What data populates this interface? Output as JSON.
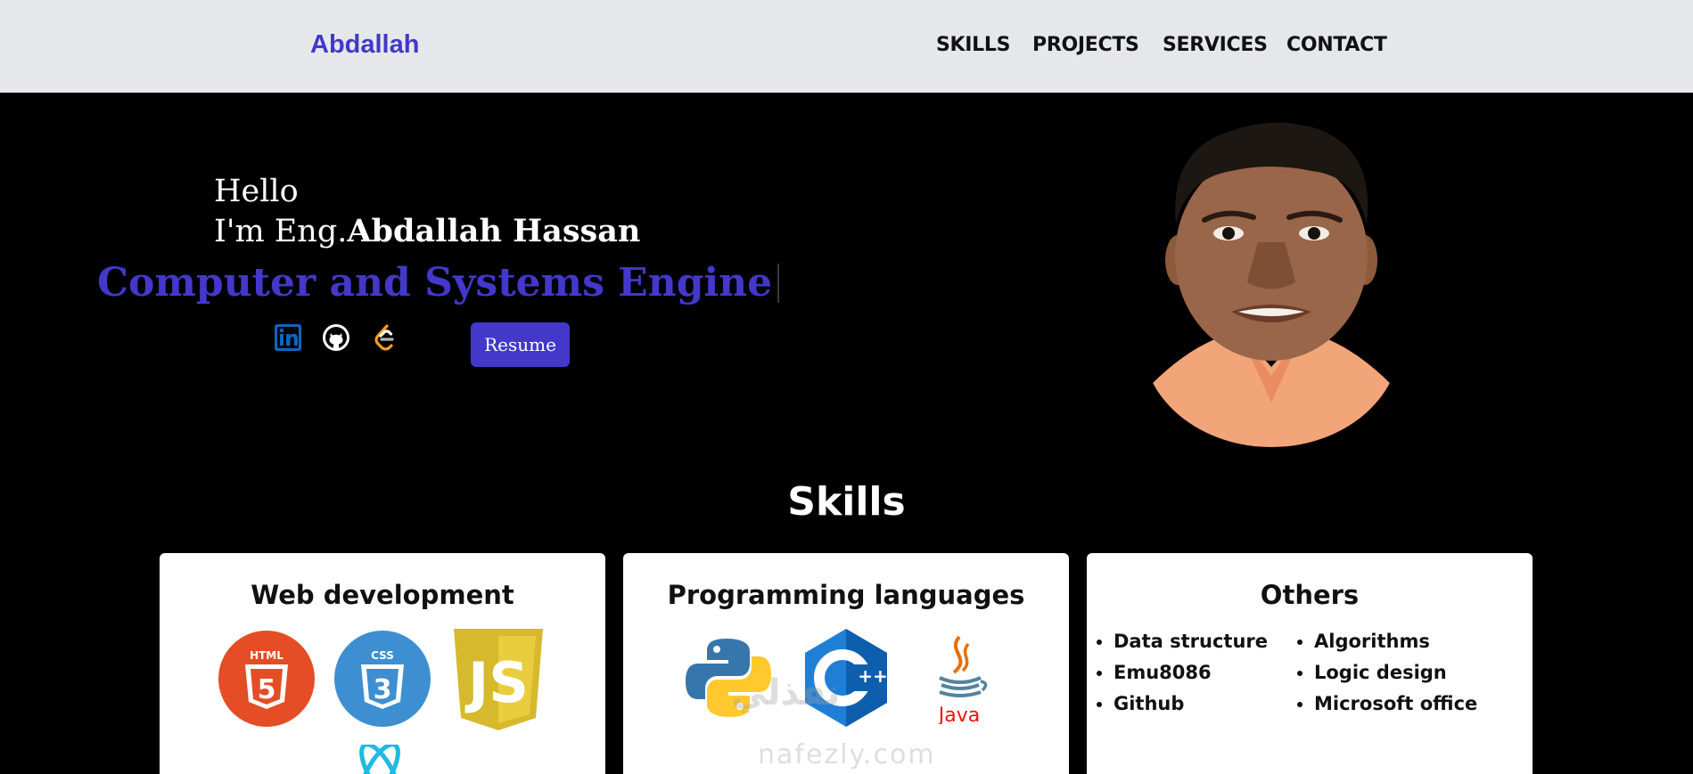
{
  "navbar": {
    "brand": "Abdallah",
    "links": [
      "SKILLS",
      "PROJECTS",
      "SERVICES",
      "CONTACT"
    ]
  },
  "hero": {
    "greeting": "Hello",
    "intro_prefix": "I'm Eng.",
    "name": "Abdallah Hassan",
    "role": "Computer and Systems Engine",
    "socials": [
      "linkedin-icon",
      "github-icon",
      "leetcode-icon"
    ],
    "resume_label": "Resume"
  },
  "skills": {
    "title": "Skills",
    "cards": [
      {
        "title": "Web development",
        "logos": [
          "html5-icon",
          "css3-icon",
          "javascript-icon",
          "react-icon"
        ]
      },
      {
        "title": "Programming languages",
        "logos": [
          "python-icon",
          "cpp-icon",
          "java-icon"
        ],
        "java_label": "Java"
      },
      {
        "title": "Others",
        "col1": [
          "Data structure",
          "Emu8086",
          "Github"
        ],
        "col2": [
          "Algorithms",
          "Logic design",
          "Microsoft office"
        ]
      }
    ]
  },
  "watermark": {
    "arabic": "نفذلي",
    "latin": "nafezly.com"
  },
  "colors": {
    "accent": "#4338ca",
    "navbar_bg": "#e6e7eb",
    "hero_bg": "#000000"
  }
}
